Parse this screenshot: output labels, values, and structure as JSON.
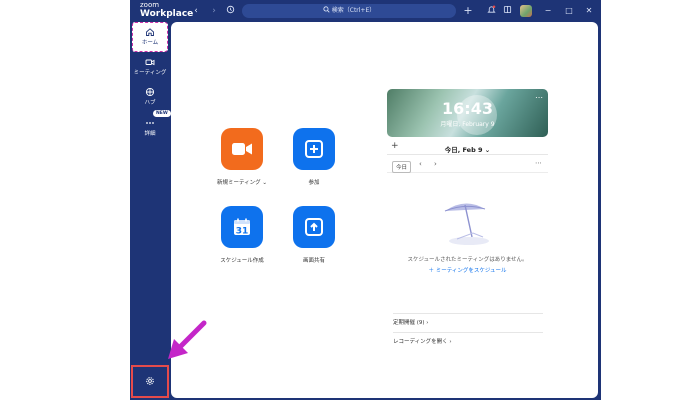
{
  "app": {
    "brand_small": "zoom",
    "brand_title": "Workplace"
  },
  "titlebar": {
    "search_placeholder": "検索（Ctrl+E）",
    "icons": [
      "back-icon",
      "forward-icon",
      "history-icon",
      "search-icon",
      "plus-icon",
      "bell-icon",
      "whiteboard-icon"
    ],
    "window_buttons": [
      "minimize",
      "maximize",
      "close"
    ]
  },
  "sidebar": {
    "items": [
      {
        "label": "ホーム",
        "icon": "home-icon",
        "active": true
      },
      {
        "label": "ミーティング",
        "icon": "video-icon"
      },
      {
        "label": "ハブ",
        "icon": "hub-icon"
      },
      {
        "label": "詳細",
        "icon": "more-icon",
        "badge": "NEW"
      }
    ],
    "settings_icon": "gear-icon"
  },
  "actions": [
    {
      "label": "新規ミーティング",
      "icon": "video-camera-icon",
      "color": "#f26b1d"
    },
    {
      "label": "参加",
      "icon": "plus-icon",
      "color": "#0e72ed"
    },
    {
      "label": "スケジュール作成",
      "icon": "calendar-icon",
      "color": "#0e72ed",
      "day_number": "31"
    },
    {
      "label": "画面共有",
      "icon": "share-up-icon",
      "color": "#0e72ed"
    }
  ],
  "calendar": {
    "time": "16:43",
    "date": "月曜日, February 9",
    "day_label": "今日, Feb 9",
    "today_button": "今日",
    "empty_message": "スケジュールされたミーティングはありません。",
    "schedule_link": "ミーティングをスケジュール",
    "rows": [
      {
        "label": "定期開催 (9)"
      },
      {
        "label": "レコーディングを開く"
      }
    ]
  },
  "colors": {
    "sidebar": "#1e3476",
    "accent_blue": "#0e72ed",
    "accent_orange": "#f26b1d",
    "highlight_red": "#e54b4b",
    "highlight_magenta": "#cc2fa8"
  }
}
